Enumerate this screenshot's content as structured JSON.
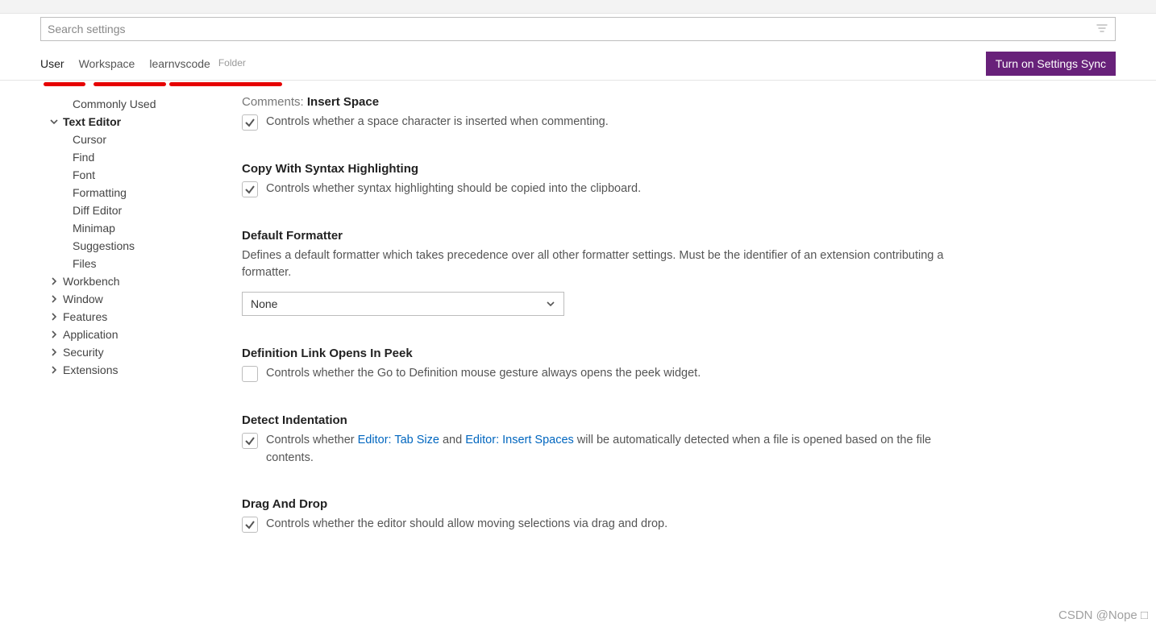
{
  "search": {
    "placeholder": "Search settings"
  },
  "tabs": {
    "user": "User",
    "workspace": "Workspace",
    "folder": "learnvscode",
    "folder_tag": "Folder"
  },
  "sync_button": "Turn on Settings Sync",
  "sidebar": {
    "commonly_used": "Commonly Used",
    "text_editor": "Text Editor",
    "children": {
      "cursor": "Cursor",
      "find": "Find",
      "font": "Font",
      "formatting": "Formatting",
      "diff_editor": "Diff Editor",
      "minimap": "Minimap",
      "suggestions": "Suggestions",
      "files": "Files"
    },
    "workbench": "Workbench",
    "window": "Window",
    "features": "Features",
    "application": "Application",
    "security": "Security",
    "extensions": "Extensions"
  },
  "settings": {
    "insert_space": {
      "cat": "Comments: ",
      "name": "Insert Space",
      "desc": "Controls whether a space character is inserted when commenting.",
      "checked": true
    },
    "copy_syntax": {
      "name": "Copy With Syntax Highlighting",
      "desc": "Controls whether syntax highlighting should be copied into the clipboard.",
      "checked": true
    },
    "default_formatter": {
      "name": "Default Formatter",
      "desc": "Defines a default formatter which takes precedence over all other formatter settings. Must be the identifier of an extension contributing a formatter.",
      "value": "None"
    },
    "def_link_peek": {
      "name": "Definition Link Opens In Peek",
      "desc": "Controls whether the Go to Definition mouse gesture always opens the peek widget.",
      "checked": false
    },
    "detect_indent": {
      "name": "Detect Indentation",
      "desc_pre": "Controls whether ",
      "link1": "Editor: Tab Size",
      "mid": " and ",
      "link2": "Editor: Insert Spaces",
      "desc_post": " will be automatically detected when a file is opened based on the file contents.",
      "checked": true
    },
    "drag_drop": {
      "name": "Drag And Drop",
      "desc": "Controls whether the editor should allow moving selections via drag and drop.",
      "checked": true
    }
  },
  "watermark": "CSDN @Nope □"
}
